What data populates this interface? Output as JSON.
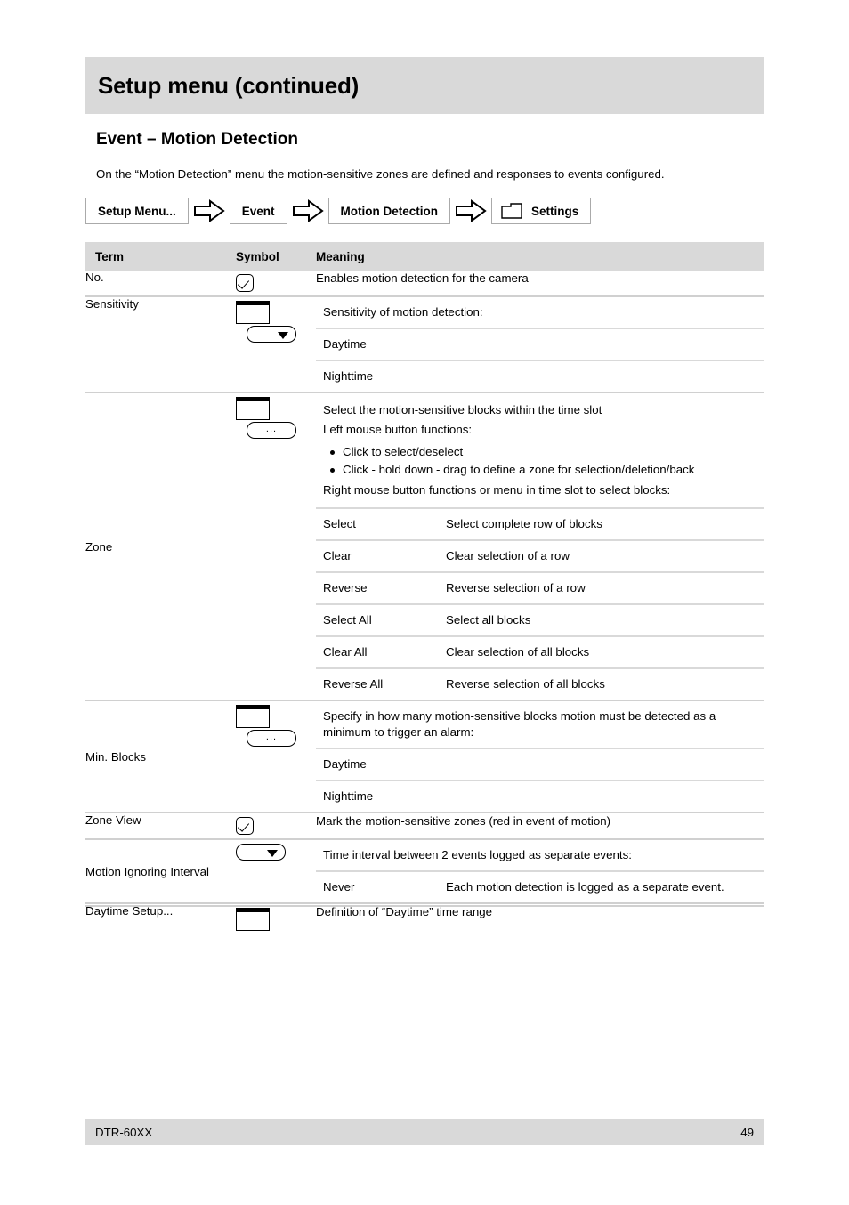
{
  "document": {
    "title": "Setup menu (continued)",
    "section_heading": "Event – Motion Detection",
    "intro": "On the “Motion Detection” menu the motion-sensitive zones are defined and responses to events configured."
  },
  "breadcrumb": {
    "items": [
      {
        "label": "Setup Menu...",
        "icon": ""
      },
      {
        "label": "Event",
        "icon": ""
      },
      {
        "label": "Motion Detection",
        "icon": ""
      },
      {
        "label": "Settings",
        "icon": "folder-icon"
      }
    ],
    "separator_icon": "arrow-right-icon"
  },
  "table": {
    "headers": {
      "term": "Term",
      "symbol": "Symbol",
      "meaning": "Meaning"
    },
    "rows": [
      {
        "term": "No.",
        "symbol": "checkbox-icon",
        "meaning": "Enables motion detection for the camera"
      },
      {
        "term": "Sensitivity",
        "symbol": "box-with-dropdown-icon",
        "meaning_intro": "Sensitivity of motion detection:",
        "sub_rows": [
          {
            "key": "Daytime",
            "value": ""
          },
          {
            "key": "Nighttime",
            "value": ""
          }
        ]
      },
      {
        "term": "Zone",
        "symbol": "box-with-ellipsis-button-icon",
        "meaning_lines": [
          "Select the motion-sensitive blocks within the time slot",
          "Left mouse button functions:"
        ],
        "bullets": [
          "Click to select/deselect",
          "Click - hold down - drag to define a zone for selection/deletion/back"
        ],
        "meaning_trailing": "Right mouse button functions or menu in time slot to select blocks:",
        "sub_rows": [
          {
            "key": "Select",
            "value": "Select complete row of blocks"
          },
          {
            "key": "Clear",
            "value": "Clear selection of a row"
          },
          {
            "key": "Reverse",
            "value": "Reverse selection of a row"
          },
          {
            "key": "Select All",
            "value": "Select all blocks"
          },
          {
            "key": "Clear All",
            "value": "Clear selection of all blocks"
          },
          {
            "key": "Reverse All",
            "value": "Reverse selection of all blocks"
          }
        ]
      },
      {
        "term": "Min. Blocks",
        "symbol": "box-with-ellipsis-button-icon",
        "meaning_intro": "Specify in how many motion-sensitive blocks motion must be detected as a minimum to trigger an alarm:",
        "sub_rows": [
          {
            "key": "Daytime",
            "value": ""
          },
          {
            "key": "Nighttime",
            "value": ""
          }
        ]
      },
      {
        "term": "Zone View",
        "symbol": "checkbox-icon",
        "meaning": "Mark the motion-sensitive zones (red in event of motion)"
      },
      {
        "term": "Motion Ignoring Interval",
        "symbol": "dropdown-icon",
        "meaning_intro": "Time interval between 2 events logged as separate events:",
        "sub_rows": [
          {
            "key": "Never",
            "value": "Each motion detection is logged as a separate event."
          }
        ]
      },
      {
        "term": "Daytime Setup...",
        "symbol": "box-icon",
        "meaning": "Definition of “Daytime” time range"
      }
    ]
  },
  "footer": {
    "model": "DTR-60XX",
    "page_number": "49"
  }
}
